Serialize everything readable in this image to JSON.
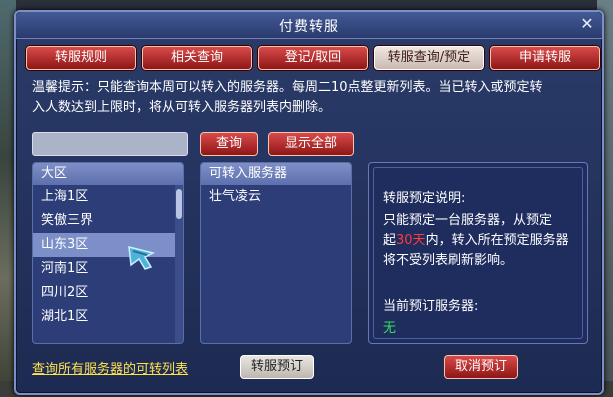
{
  "window": {
    "title": "付费转服",
    "close_glyph": "✕"
  },
  "tabs": [
    {
      "label": "转服规则"
    },
    {
      "label": "相关查询"
    },
    {
      "label": "登记/取回"
    },
    {
      "label": "转服查询/预定"
    },
    {
      "label": "申请转服"
    }
  ],
  "notice": {
    "line1": "温馨提示：只能查询本周可以转入的服务器。每周二10点整更新列表。当已转入或预定转",
    "line2": "入人数达到上限时，将从可转入服务器列表内删除。"
  },
  "search": {
    "value": "",
    "query_label": "查询",
    "show_all_label": "显示全部"
  },
  "region_panel": {
    "header": "大区",
    "items": [
      "上海1区",
      "笑傲三界",
      "山东3区",
      "河南1区",
      "四川2区",
      "湖北1区"
    ],
    "selected": "山东3区"
  },
  "server_panel": {
    "header": "可转入服务器",
    "items": [
      "壮气凌云"
    ]
  },
  "info": {
    "title": "转服预定说明:",
    "line1": "只能预定一台服务器，从预定",
    "line2_pre": "起",
    "line2_red": "30天",
    "line2_post": "内，转入所在预定服务器",
    "line3": "将不受列表刷新影响。",
    "current_label": "当前预订服务器:",
    "current_value": "无"
  },
  "footer": {
    "link": "查询所有服务器的可转列表",
    "reserve_label": "转服预订",
    "cancel_label": "取消预订"
  },
  "colors": {
    "accent_red": "#8f1616",
    "panel_blue": "#2c3d78",
    "link_yellow": "#ffe34d",
    "status_green": "#33e05c"
  }
}
